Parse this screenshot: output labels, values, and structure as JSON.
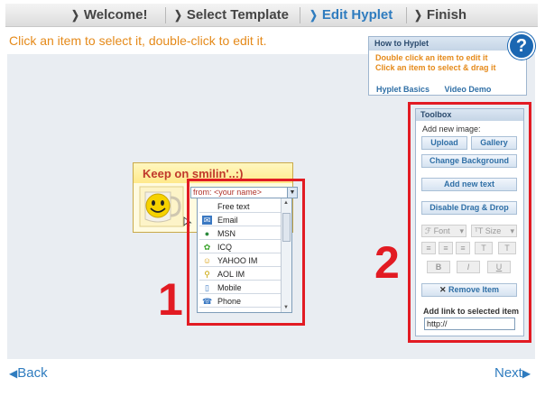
{
  "wizard": {
    "steps": [
      {
        "label": "Welcome!"
      },
      {
        "label": "Select Template"
      },
      {
        "label": "Edit Hyplet"
      },
      {
        "label": "Finish"
      }
    ]
  },
  "instruction": "Click an item to select it, double-click to edit it.",
  "howto": {
    "title": "How to Hyplet",
    "line1": "Double click an item to edit it",
    "line2": "Click an item to select & drag it",
    "link_basics": "Hyplet Basics",
    "link_video": "Video Demo",
    "help_glyph": "?"
  },
  "card": {
    "title": "Keep on smilin'..:)",
    "from_value": "from: <your name>"
  },
  "dropdown": {
    "items": [
      {
        "label": "Free text",
        "icon": ""
      },
      {
        "label": "Email",
        "icon": "email-icon"
      },
      {
        "label": "MSN",
        "icon": "msn-icon"
      },
      {
        "label": "ICQ",
        "icon": "icq-icon"
      },
      {
        "label": "YAHOO IM",
        "icon": "yahoo-icon"
      },
      {
        "label": "AOL IM",
        "icon": "aol-icon"
      },
      {
        "label": "Mobile",
        "icon": "mobile-icon"
      },
      {
        "label": "Phone",
        "icon": "phone-icon"
      }
    ]
  },
  "annotations": {
    "num1": "1",
    "num2": "2"
  },
  "toolbox": {
    "title": "Toolbox",
    "add_image_label": "Add new image:",
    "upload": "Upload",
    "gallery": "Gallery",
    "change_background": "Change Background",
    "add_text": "Add new text",
    "disable_drag": "Disable Drag & Drop",
    "font": "Font",
    "size": "Size",
    "bold": "B",
    "italic": "I",
    "underline": "U",
    "remove_item": "Remove Item",
    "add_link_label": "Add link to selected item",
    "link_value": "http://"
  },
  "nav": {
    "back": "Back",
    "next": "Next"
  },
  "colors": {
    "accent_blue": "#2f7cbf",
    "instruction_orange": "#e58a1a",
    "highlight_red": "#e21b23"
  }
}
